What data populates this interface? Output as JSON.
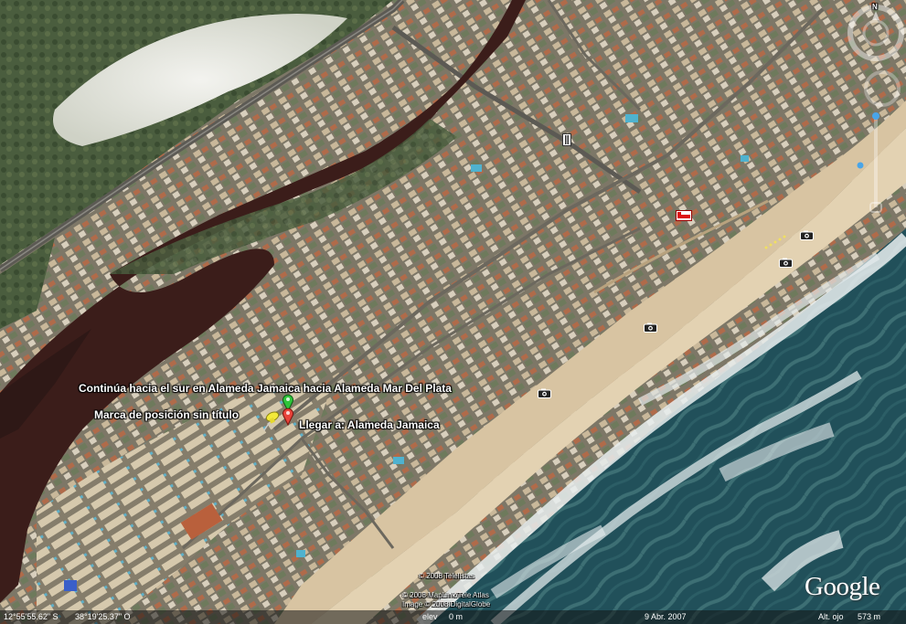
{
  "labels": {
    "route_instruction": "Continúa hacia el sur en Alameda Jamaica hacia Alameda Mar Del Plata",
    "placemark_untitled": "Marca de posición sin título",
    "arrive": "Llegar a: Alameda Jamaica"
  },
  "copyright": {
    "line1": "© 2008 Telelistas",
    "line2": "© 2008 MapLink/Tele Atlas",
    "line3": "Image © 2008 DigitalGlobe"
  },
  "logo": "Google",
  "status": {
    "lat": "12°55'55.62\" S",
    "lon": "38°19'25.37\" O",
    "elev_label": "elev",
    "elev_value": "0 m",
    "date": "9 Abr. 2007",
    "alt_label": "Alt. ojo",
    "alt_value": "573 m"
  },
  "compass": {
    "north": "N"
  },
  "icons": [
    "camera-icon",
    "pushpin-icon",
    "hotel-icon",
    "nav-compass-icon",
    "zoom-slider-icon"
  ],
  "colors": {
    "ocean": "#1f4f55",
    "surf": "#e8eef0",
    "sand": "#d9c6a4",
    "river": "#3a1b1a",
    "vegetation": "#3f5a3a",
    "urban": "#8c8474"
  }
}
